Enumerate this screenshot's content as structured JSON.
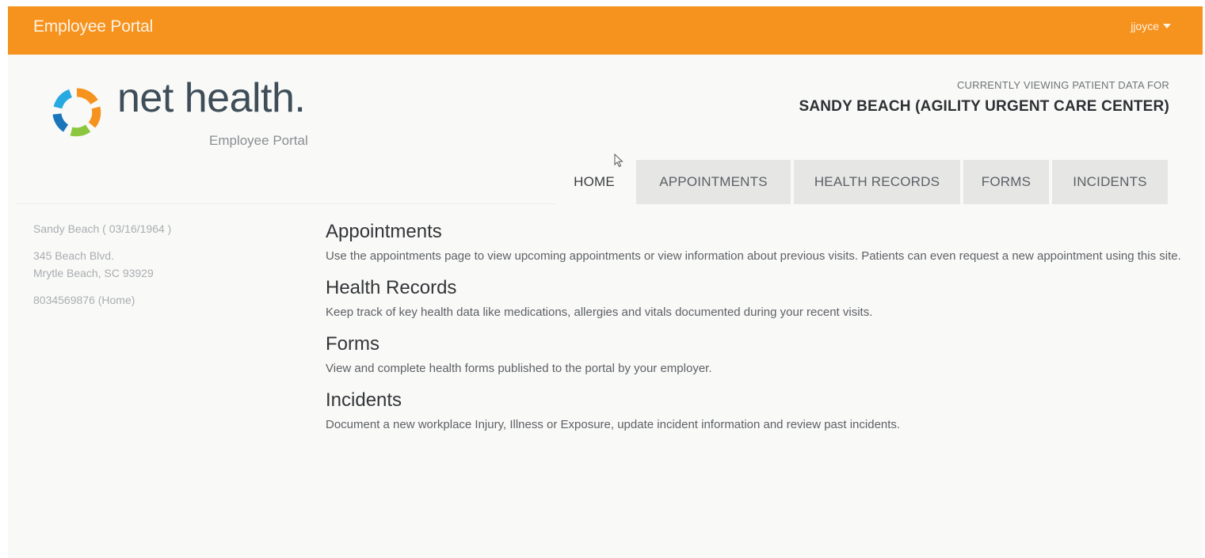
{
  "header": {
    "brand": "Employee Portal",
    "user": "jjoyce",
    "color": "#f6921e"
  },
  "logo": {
    "wordmark": "net health.",
    "subtitle": "Employee Portal",
    "ring_colors": [
      "#f6921e",
      "#8cc63f",
      "#1b75bb",
      "#27aae1"
    ]
  },
  "viewing": {
    "caption": "CURRENTLY VIEWING PATIENT DATA FOR",
    "patient": "SANDY BEACH (AGILITY URGENT CARE CENTER)"
  },
  "tabs": {
    "home": "HOME",
    "appointments": "APPOINTMENTS",
    "health_records": "HEALTH RECORDS",
    "forms": "FORMS",
    "incidents": "INCIDENTS",
    "active": "home"
  },
  "patient": {
    "name_dob": "Sandy Beach ( 03/16/1964 )",
    "address_line1": "345 Beach Blvd.",
    "address_line2": "Mrytle Beach, SC 93929",
    "phone": "8034569876 (Home)"
  },
  "sections": {
    "appointments": {
      "title": "Appointments",
      "body": "Use the appointments page to view upcoming appointments or view information about previous visits. Patients can even request a new appointment using this site."
    },
    "health_records": {
      "title": "Health Records",
      "body": "Keep track of key health data like medications, allergies and vitals documented during your recent visits."
    },
    "forms": {
      "title": "Forms",
      "body": "View and complete health forms published to the portal by your employer."
    },
    "incidents": {
      "title": "Incidents",
      "body": "Document a new workplace Injury, Illness or Exposure, update incident information and review past incidents."
    }
  }
}
